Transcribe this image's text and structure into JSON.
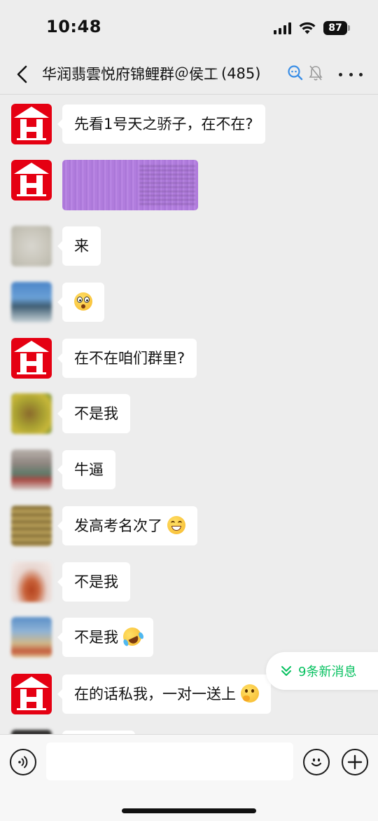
{
  "status_bar": {
    "time": "10:48",
    "battery": "87",
    "icons": [
      "signal-icon",
      "wifi-icon",
      "battery-icon"
    ]
  },
  "header": {
    "title": "华润翡雲悦府锦鲤群＠侯工",
    "member_count": "(485)",
    "icons": [
      "back-chevron-icon",
      "chat-search-icon",
      "muted-bell-icon",
      "more-dots-icon"
    ]
  },
  "messages": [
    {
      "sender_avatar": "hr-logo-avatar",
      "type": "text",
      "text": "先看1号天之骄子，在不在?"
    },
    {
      "sender_avatar": "hr-logo-avatar",
      "type": "image",
      "text": ""
    },
    {
      "sender_avatar": "blurred-avatar",
      "type": "text",
      "text": "来"
    },
    {
      "sender_avatar": "blurred-avatar",
      "type": "emoji",
      "text": "",
      "emoji": "flushed-face-icon"
    },
    {
      "sender_avatar": "hr-logo-avatar",
      "type": "text",
      "text": "在不在咱们群里?"
    },
    {
      "sender_avatar": "blurred-avatar",
      "type": "text",
      "text": "不是我"
    },
    {
      "sender_avatar": "blurred-avatar",
      "type": "text",
      "text": "牛逼"
    },
    {
      "sender_avatar": "blurred-avatar",
      "type": "text",
      "text": "发高考名次了",
      "emoji": "grinning-face-icon"
    },
    {
      "sender_avatar": "blurred-avatar",
      "type": "text",
      "text": "不是我"
    },
    {
      "sender_avatar": "blurred-avatar",
      "type": "text",
      "text": "不是我",
      "emoji": "rolling-laughing-face-icon"
    },
    {
      "sender_avatar": "hr-logo-avatar",
      "type": "text",
      "text": "在的话私我，一对一送上",
      "emoji": "thinking-face-icon"
    }
  ],
  "new_messages": {
    "label": "9条新消息",
    "icon": "double-chevron-down-icon",
    "color": "#07c160"
  },
  "input_bar": {
    "placeholder": "",
    "icons": [
      "voice-icon",
      "emoji-icon",
      "plus-icon"
    ]
  },
  "colors": {
    "background": "#ededed",
    "bubble": "#ffffff",
    "brand_red": "#e50012",
    "accent_green": "#07c160"
  }
}
